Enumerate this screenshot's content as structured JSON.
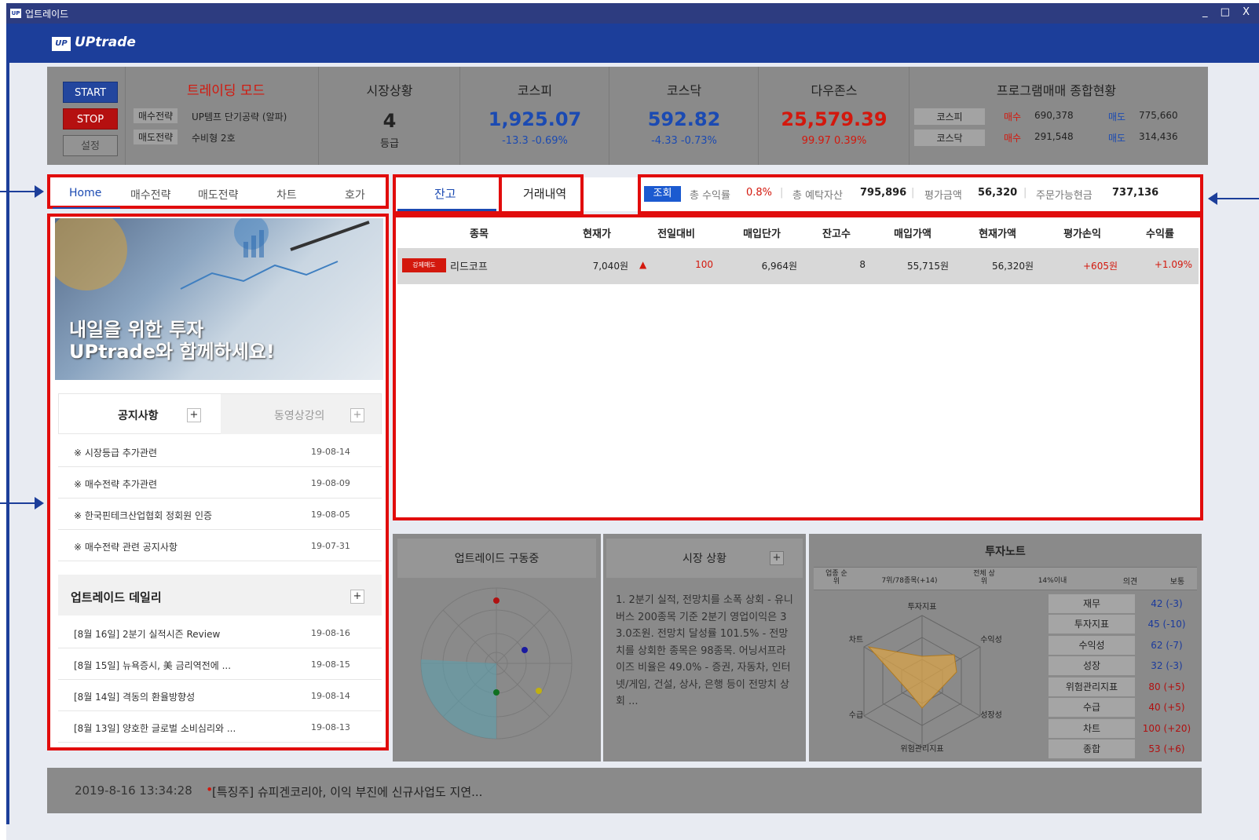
{
  "window": {
    "title": "업트레이드",
    "icon": "UP",
    "controls": "_ □ X"
  },
  "header": {
    "logo_mark": "UP",
    "logo_text": "UPtrade"
  },
  "controls": {
    "start": "START",
    "stop": "STOP",
    "settings": "설정"
  },
  "trading_mode": {
    "title": "트레이딩 모드",
    "buy_label": "매수전략",
    "buy_value": "UP템프 단기공략 (알파)",
    "sell_label": "매도전략",
    "sell_value": "수비형 2호"
  },
  "market_status": {
    "title": "시장상황",
    "value": "4",
    "unit": "등급"
  },
  "kospi": {
    "title": "코스피",
    "value": "1,925.07",
    "change": "-13.3 -0.69%"
  },
  "kosdaq": {
    "title": "코스닥",
    "value": "592.82",
    "change": "-4.33 -0.73%"
  },
  "dow": {
    "title": "다우존스",
    "value": "25,579.39",
    "change": "99.97 0.39%"
  },
  "program": {
    "title": "프로그램매매 종합현황",
    "rows": [
      {
        "market": "코스피",
        "buy_label": "매수",
        "buy": "690,378",
        "sell_label": "매도",
        "sell": "775,660"
      },
      {
        "market": "코스닥",
        "buy_label": "매수",
        "buy": "291,548",
        "sell_label": "매도",
        "sell": "314,436"
      }
    ]
  },
  "left_tabs": [
    "Home",
    "매수전략",
    "매도전략",
    "차트",
    "호가"
  ],
  "banner": {
    "line1": "내일을 위한 투자",
    "line2": "UPtrade와 함께하세요!"
  },
  "notice": {
    "tab_active": "공지사항",
    "tab_inactive": "동영상강의",
    "plus": "+",
    "items": [
      {
        "title": "※ 시장등급 추가관련",
        "date": "19-08-14"
      },
      {
        "title": "※ 매수전략 추가관련",
        "date": "19-08-09"
      },
      {
        "title": "※ 한국핀테크산업협회 정회원 인증",
        "date": "19-08-05"
      },
      {
        "title": "※ 매수전략 관련 공지사항",
        "date": "19-07-31"
      }
    ]
  },
  "daily": {
    "title": "업트레이드 데일리",
    "plus": "+",
    "items": [
      {
        "title": "[8월 16일] 2분기 실적시즌 Review",
        "date": "19-08-16"
      },
      {
        "title": "[8월 15일] 뉴욕증시, 美 금리역전에 ...",
        "date": "19-08-15"
      },
      {
        "title": "[8월 14일] 격동의 환율방향성",
        "date": "19-08-14"
      },
      {
        "title": "[8월 13일] 양호한 글로벌 소비심리와 ...",
        "date": "19-08-13"
      }
    ]
  },
  "right_tabs": [
    "잔고",
    "거래내역"
  ],
  "summary": {
    "button": "조회",
    "profit_label": "총 수익률",
    "profit": "0.8%",
    "assets_label": "총 예탁자산",
    "assets": "795,896",
    "eval_label": "평가금액",
    "eval": "56,320",
    "cash_label": "주문가능현금",
    "cash": "737,136"
  },
  "grid": {
    "headers": [
      "종목",
      "현재가",
      "전일대비",
      "매입단가",
      "잔고수",
      "매입가액",
      "현재가액",
      "평가손익",
      "수익률"
    ],
    "rows": [
      {
        "badge": "강제매도",
        "name": "리드코프",
        "price": "7,040원",
        "arrow": "▲",
        "change": "100",
        "buy_price": "6,964원",
        "qty": "8",
        "buy_amt": "55,715원",
        "cur_amt": "56,320원",
        "pnl": "+605원",
        "rate": "+1.09%"
      }
    ]
  },
  "bottom": {
    "engine_title": "업트레이드 구동중",
    "market_title": "시장 상황",
    "market_plus": "+",
    "market_text": "1. 2분기 실적, 전망치를 소폭 상회 - 유니버스 200종목 기준 2분기 영업이익은 33.0조원. 전망치 달성률 101.5% - 전망치를 상회한 종목은 98종목. 어닝서프라이즈 비율은 49.0% - 증권, 자동차, 인터넷/게임, 건설, 상사, 은행 등이 전망치 상회 ...",
    "note_title": "투자노트",
    "note_header": [
      "업종 순위",
      "7위/78종목(+14)",
      "전체 상위",
      "14%이내",
      "의견",
      "보통"
    ],
    "radar_labels": [
      "투자지표",
      "수익성",
      "성장성",
      "위험관리지표",
      "수급",
      "차트"
    ],
    "note_rows": [
      {
        "label": "재무",
        "value": "42 (-3)"
      },
      {
        "label": "투자지표",
        "value": "45 (-10)"
      },
      {
        "label": "수익성",
        "value": "62 (-7)"
      },
      {
        "label": "성장",
        "value": "32 (-3)"
      },
      {
        "label": "위험관리지표",
        "value": "80 (+5)"
      },
      {
        "label": "수급",
        "value": "40 (+5)"
      },
      {
        "label": "차트",
        "value": "100 (+20)"
      },
      {
        "label": "종합",
        "value": "53 (+6)"
      }
    ]
  },
  "news": {
    "timestamp": "2019-8-16 13:34:28",
    "bullet": "•",
    "headline": "[특징주] 슈피겐코리아, 이익 부진에 신규사업도 지연..."
  }
}
